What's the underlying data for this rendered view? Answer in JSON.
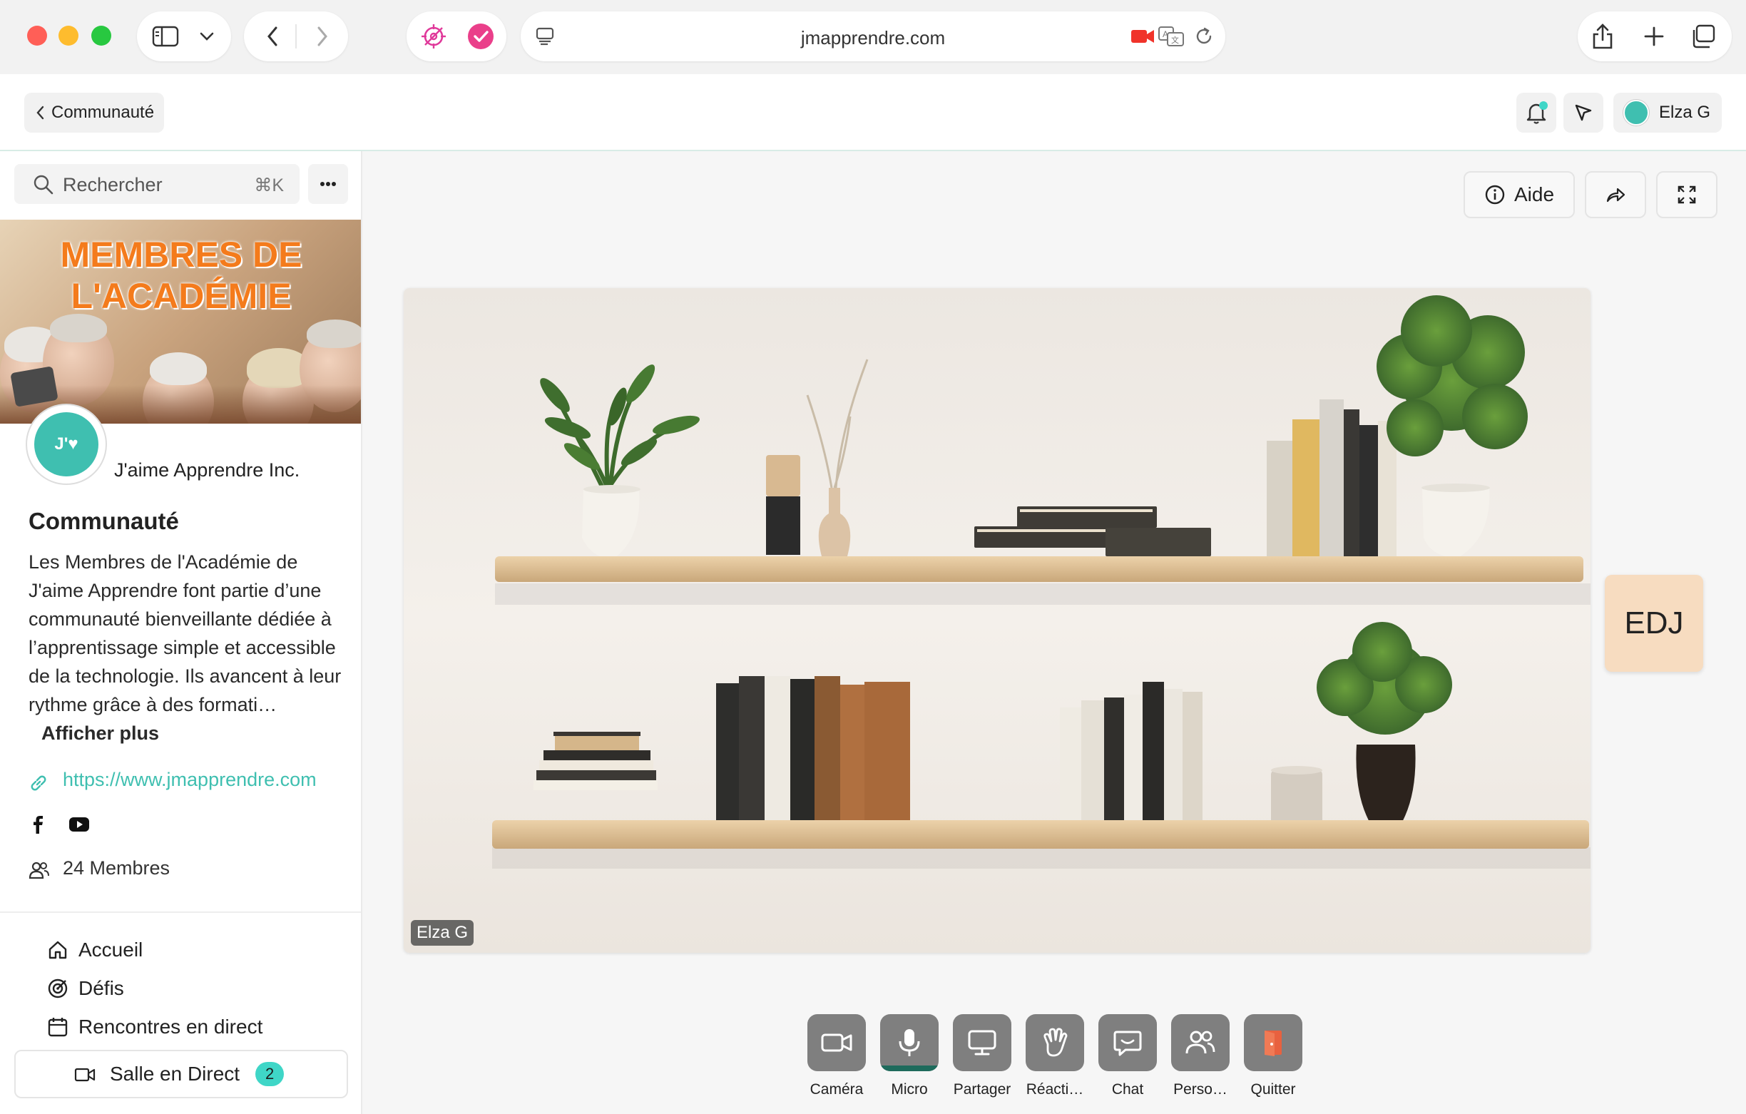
{
  "browser": {
    "url": "jmapprendre.com"
  },
  "header": {
    "back_label": "Communauté",
    "user_name": "Elza G"
  },
  "sidebar": {
    "search_placeholder": "Rechercher",
    "search_shortcut": "⌘K",
    "banner_title_line1": "MEMBRES DE",
    "banner_title_line2": "L'ACADÉMIE",
    "logo_text": "J'♥",
    "org_name": "J'aime Apprendre Inc.",
    "community_title": "Communauté",
    "description": "Les Membres de l'Académie de J'aime Apprendre font partie d’une communauté bienveillante dédiée à l’apprentissage simple et accessible de la technologie. Ils avancent à leur rythme grâce à des formati…",
    "show_more": "Afficher plus",
    "website": "https://www.jmapprendre.com",
    "members_count": "24 Membres",
    "nav": {
      "accueil": "Accueil",
      "defis": "Défis",
      "rencontres": "Rencontres en direct",
      "salle": "Salle en Direct",
      "salle_badge": "2"
    }
  },
  "main": {
    "help_label": "Aide",
    "video_name_tag": "Elza G",
    "participant_initials": "EDJ",
    "controls": {
      "camera": "Caméra",
      "micro": "Micro",
      "partager": "Partager",
      "reactions": "Réacti…",
      "chat": "Chat",
      "personnes": "Perso…",
      "quitter": "Quitter"
    }
  },
  "colors": {
    "accent": "#3fbfb0",
    "quit": "#e8613f",
    "micro_active": "#1e6b5c"
  }
}
